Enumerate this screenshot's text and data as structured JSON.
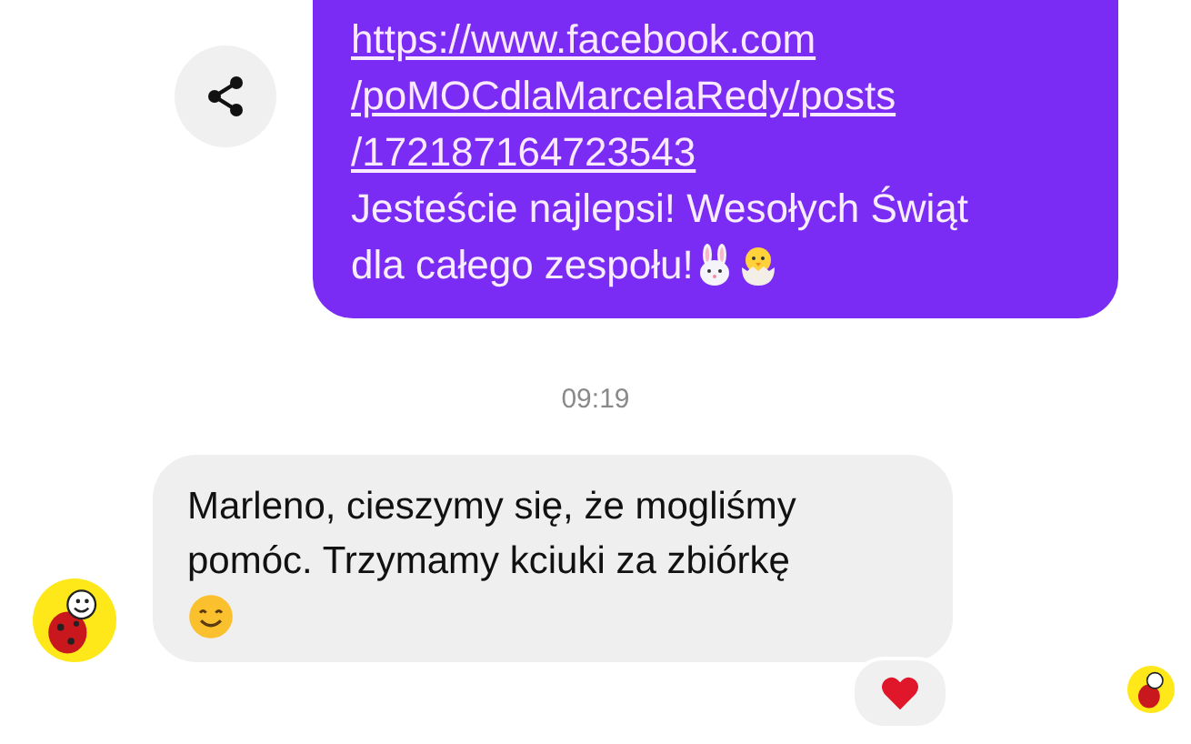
{
  "outgoing_message": {
    "link_lines": [
      "https://www.facebook.com",
      "/poMOCdlaMarcelaRedy/posts",
      "/172187164723543"
    ],
    "text_lines": [
      "Jesteście najlepsi! Wesołych Świąt",
      "dla całego zespołu!"
    ],
    "emojis": [
      {
        "kind": "bunny"
      },
      {
        "kind": "chick"
      }
    ]
  },
  "timestamp": "09:19",
  "incoming_message": {
    "text": "Marleno, cieszymy się, że mogliśmy pomóc. Trzymamy kciuki za zbiórkę",
    "emojis": [
      {
        "kind": "smile"
      }
    ],
    "reaction": {
      "kind": "heart"
    }
  }
}
